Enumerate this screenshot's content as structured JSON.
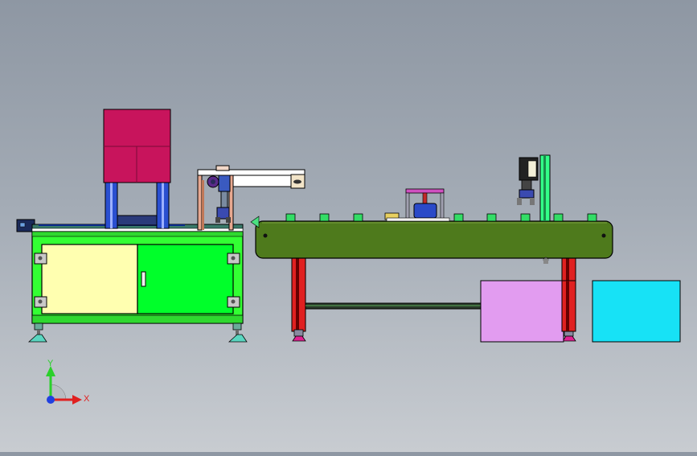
{
  "triad": {
    "x_label": "X",
    "y_label": "Y"
  },
  "colors": {
    "frame_green": "#33ff33",
    "door_yellow": "#ffffb0",
    "hopper_magenta": "#c8145c",
    "conveyor_green": "#4e7a1c",
    "box_violet": "#e29cf0",
    "box_cyan": "#17e2f6"
  }
}
